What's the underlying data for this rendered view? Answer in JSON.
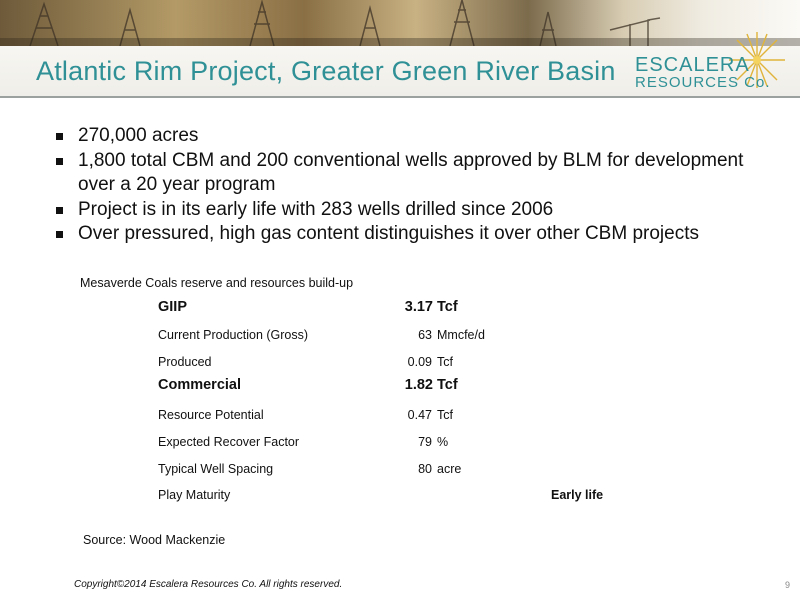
{
  "slide": {
    "title": "Atlantic Rim Project, Greater Green River Basin",
    "logo": {
      "line1": "ESCALERA",
      "line2": "RESOURCES Co."
    },
    "bullets": [
      "270,000 acres",
      "1,800 total CBM and 200 conventional wells approved by BLM for development over a 20 year program",
      "Project is in its early life with 283 wells drilled since 2006",
      "Over pressured, high gas content distinguishes it over other CBM projects"
    ],
    "table": {
      "caption": "Mesaverde Coals reserve and resources build-up",
      "rows": [
        {
          "label": "GIIP",
          "value": "3.17",
          "unit": "Tcf"
        },
        {
          "label": "Current Production (Gross)",
          "value": "63",
          "unit": "Mmcfe/d"
        },
        {
          "label": "Produced",
          "value": "0.09",
          "unit": "Tcf"
        },
        {
          "label": "Commercial",
          "value": "1.82",
          "unit": "Tcf"
        },
        {
          "label": "Resource Potential",
          "value": "0.47",
          "unit": "Tcf"
        },
        {
          "label": "Expected Recover Factor",
          "value": "79",
          "unit": "%"
        },
        {
          "label": "Typical Well Spacing",
          "value": "80",
          "unit": "acre"
        },
        {
          "label": "Play Maturity",
          "value": "Early life",
          "unit": ""
        }
      ]
    },
    "source": "Source:  Wood Mackenzie",
    "copyright": "Copyright©2014 Escalera Resources Co. All rights reserved.",
    "page_number": "9"
  }
}
